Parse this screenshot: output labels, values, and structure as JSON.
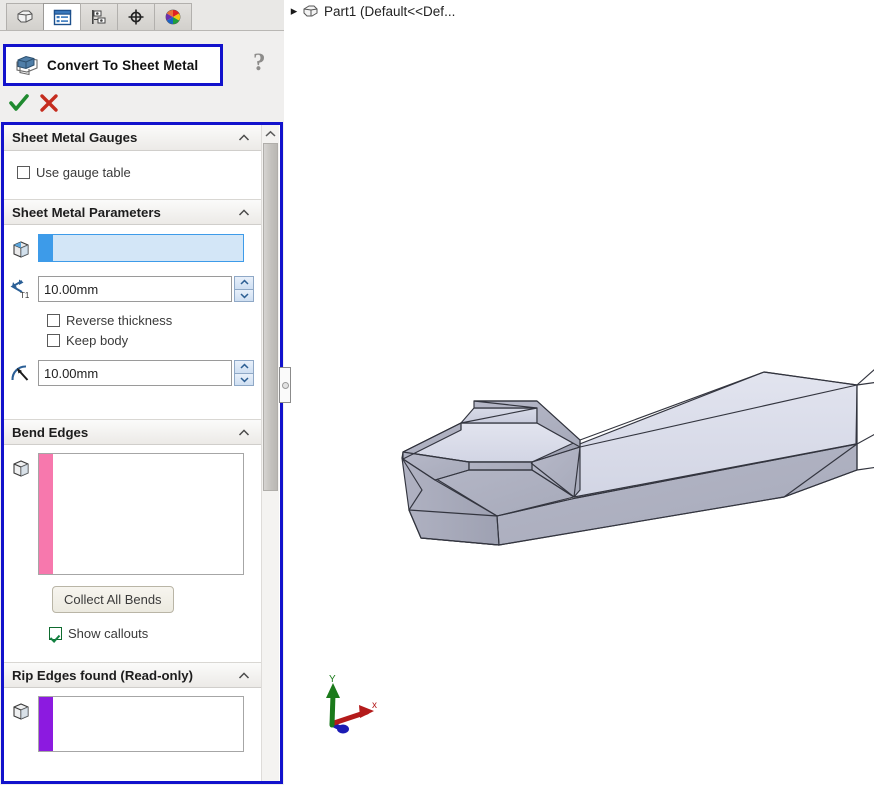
{
  "app": {
    "accent_blue": "#1212cc",
    "select_blue": "#3d9be9",
    "bend_pink": "#f778ad",
    "rip_purple": "#8c1ae0"
  },
  "tabs": [
    {
      "name": "feature-manager-tab",
      "icon": "part-shape-icon",
      "active": false
    },
    {
      "name": "property-manager-tab",
      "icon": "list-panel-icon",
      "active": true
    },
    {
      "name": "configuration-manager-tab",
      "icon": "configuration-flag-icon",
      "active": false
    },
    {
      "name": "dimxpert-manager-tab",
      "icon": "crosshair-target-icon",
      "active": false
    },
    {
      "name": "display-manager-tab",
      "icon": "color-wheel-icon",
      "active": false
    }
  ],
  "property_manager": {
    "title": "Convert To Sheet Metal",
    "title_icon": "convert-to-sheet-metal-icon",
    "help_label": "?",
    "ok_label": "✓",
    "cancel_label": "✕"
  },
  "groups": {
    "gauges": {
      "title": "Sheet Metal Gauges",
      "use_gauge_table": {
        "label": "Use gauge table",
        "checked": false
      }
    },
    "parameters": {
      "title": "Sheet Metal Parameters",
      "fixed_face": {
        "icon": "fixed-face-cube-icon",
        "value": ""
      },
      "thickness": {
        "icon": "thickness-t1-icon",
        "value": "10.00mm"
      },
      "reverse_thickness": {
        "label": "Reverse thickness",
        "checked": false
      },
      "keep_body": {
        "label": "Keep body",
        "checked": false
      },
      "bend_radius": {
        "icon": "bend-radius-arc-icon",
        "value": "10.00mm"
      }
    },
    "bend_edges": {
      "title": "Bend Edges",
      "selection_icon": "edge-selection-cube-icon",
      "items": [],
      "collect_button": "Collect All Bends",
      "show_callouts": {
        "label": "Show callouts",
        "checked": true
      }
    },
    "rip_edges": {
      "title": "Rip Edges found (Read-only)",
      "selection_icon": "edge-selection-cube-icon",
      "items": []
    }
  },
  "document": {
    "tree_label": "Part1  (Default<<Def...",
    "tree_icon": "part-document-icon",
    "expander": "▸"
  },
  "triad": {
    "x_label": "x",
    "y_label": "Y",
    "x_color": "#cc1111",
    "y_color": "#117711",
    "z_color": "#1111cc"
  },
  "model": {
    "name": "sheet-metal-part-body",
    "origin_marker": "origin-triad-marker"
  }
}
